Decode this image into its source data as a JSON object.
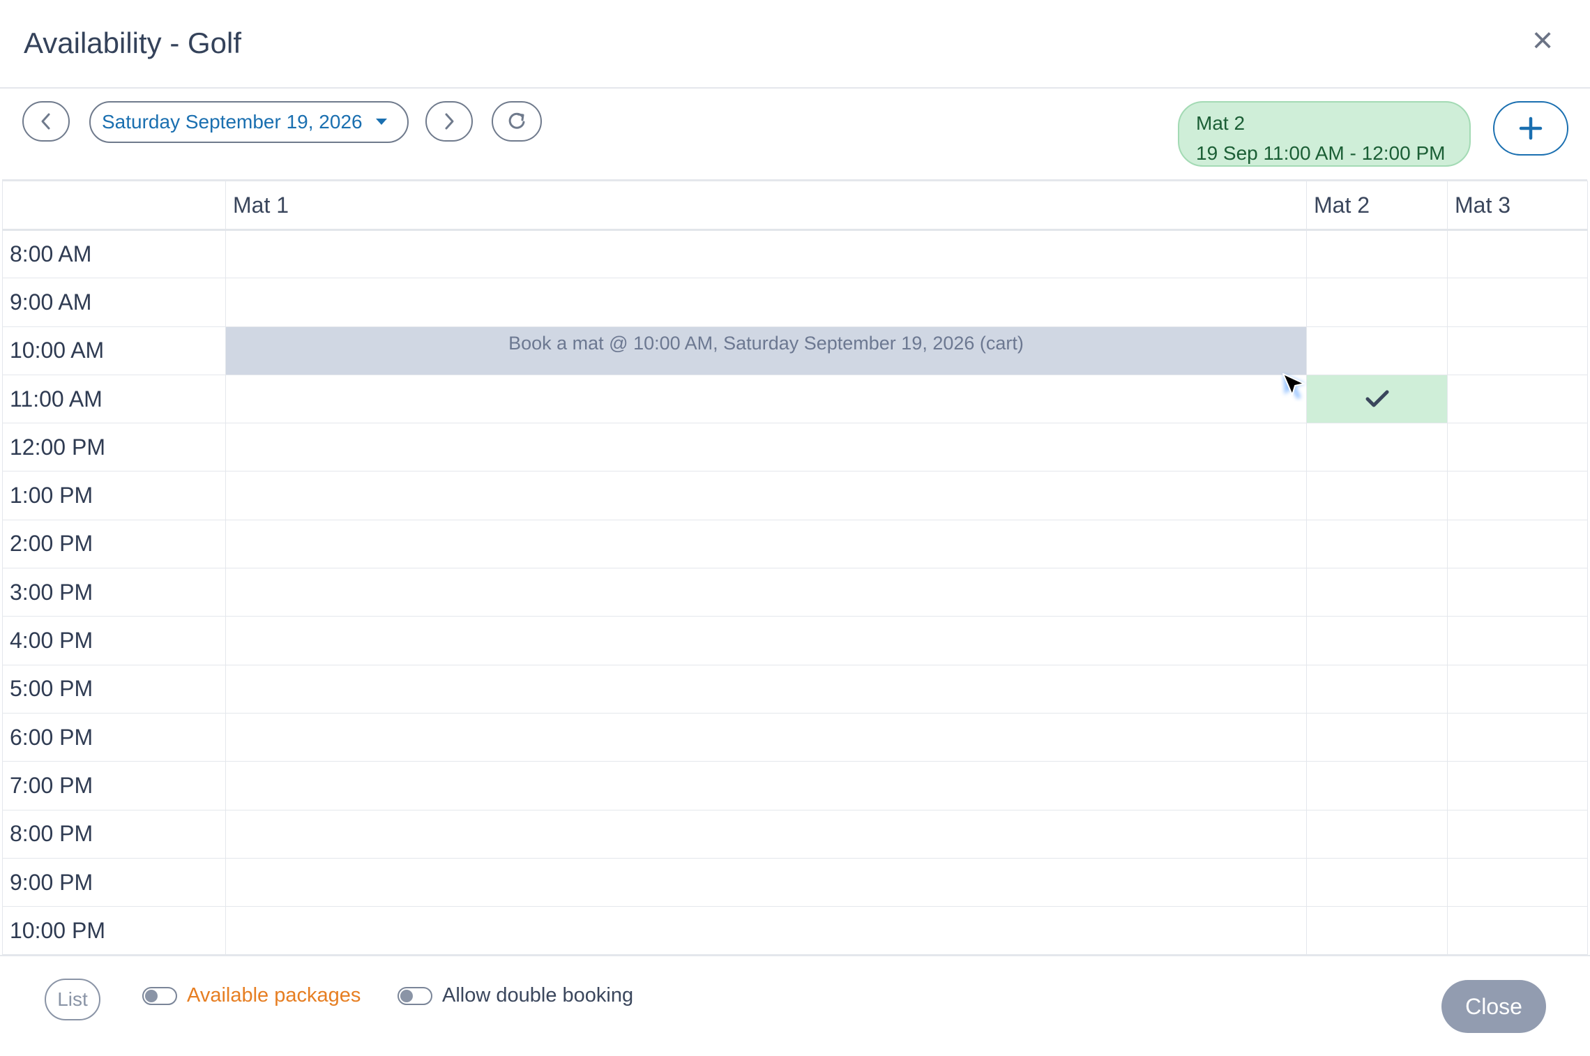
{
  "window": {
    "title": "Availability - Golf",
    "close_icon": "close-icon"
  },
  "toolbar": {
    "date_label": "Saturday September 19, 2026",
    "cart_item": {
      "resource": "Mat 2",
      "time": "19 Sep 11:00 AM - 12:00 PM"
    }
  },
  "grid": {
    "columns": [
      "Mat 1",
      "Mat 2",
      "Mat 3"
    ],
    "rows": [
      "8:00 AM",
      "9:00 AM",
      "10:00 AM",
      "11:00 AM",
      "12:00 PM",
      "1:00 PM",
      "2:00 PM",
      "3:00 PM",
      "4:00 PM",
      "5:00 PM",
      "6:00 PM",
      "7:00 PM",
      "8:00 PM",
      "9:00 PM",
      "10:00 PM"
    ],
    "hover_text": "Book a mat @ 10:00 AM, Saturday September 19, 2026 (cart)"
  },
  "footer": {
    "list_label": "List",
    "available_packages_label": "Available packages",
    "allow_double_booking_label": "Allow double booking",
    "close_label": "Close"
  },
  "colors": {
    "accent": "#1a6fb0",
    "selected": "#cfeed8",
    "hover": "#d0d7e3",
    "packages": "#e67e22"
  }
}
